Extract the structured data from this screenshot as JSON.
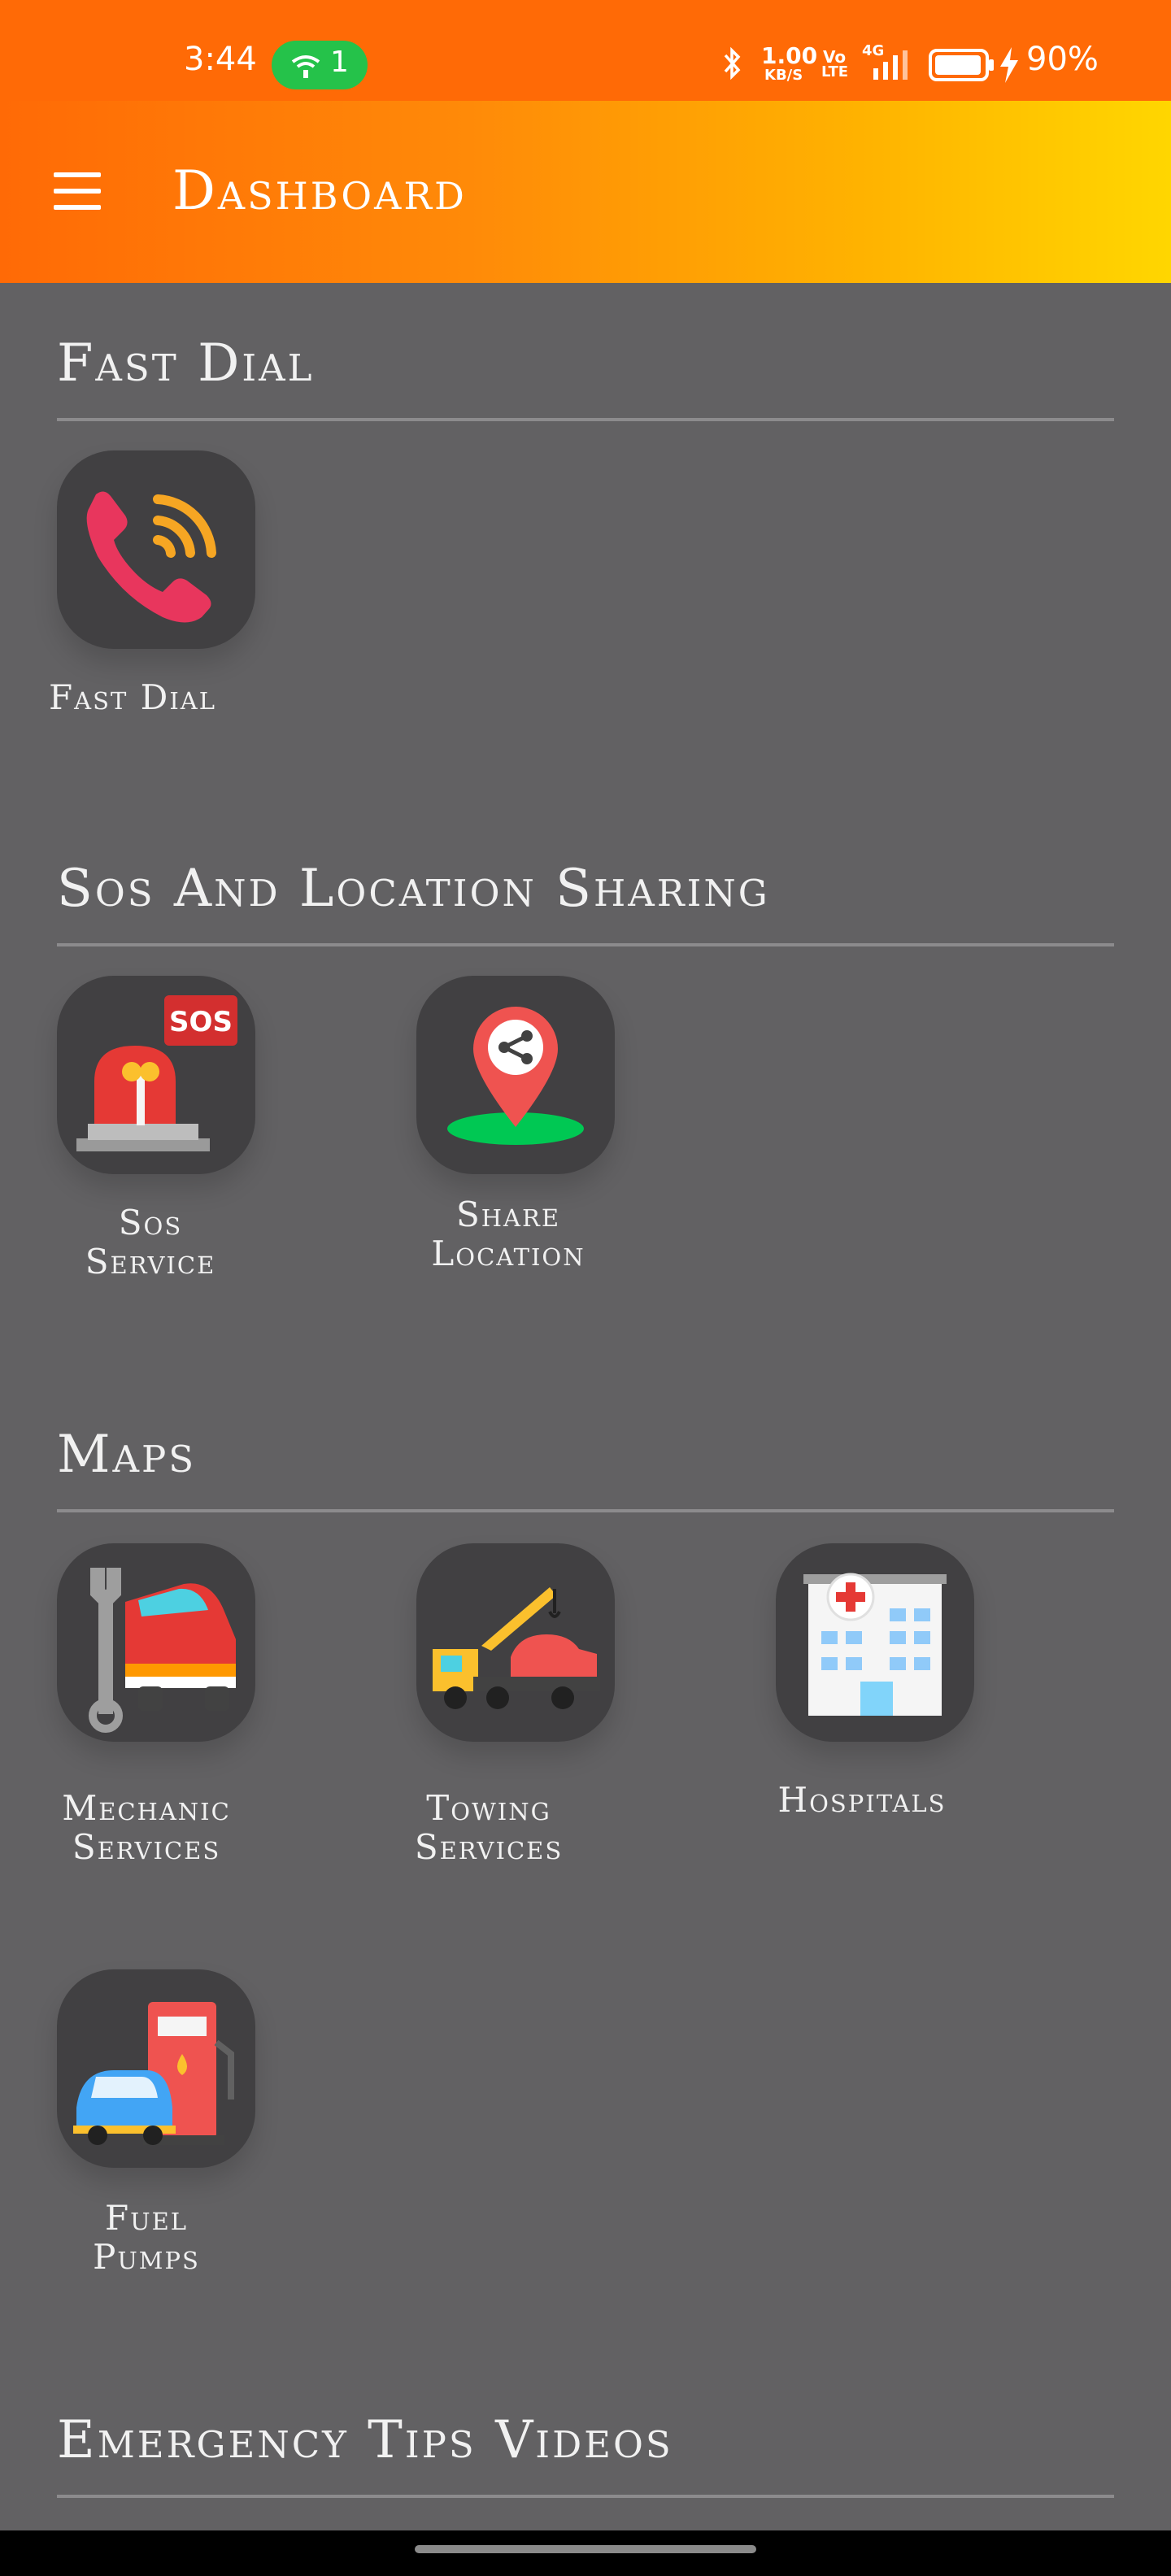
{
  "status_bar": {
    "time": "3:44",
    "hotspot_count": "1",
    "net_speed_value": "1.00",
    "net_speed_unit": "KB/S",
    "volte_top": "Vo",
    "volte_bottom": "LTE",
    "network_type": "4G",
    "battery_percent": "90%"
  },
  "app_bar": {
    "title": "Dashboard"
  },
  "sections": [
    {
      "title": "Fast Dial",
      "items": [
        {
          "label": "Fast Dial"
        }
      ]
    },
    {
      "title": "Sos And Location Sharing",
      "items": [
        {
          "label": "Sos\nService"
        },
        {
          "label": "Share\nLocation"
        }
      ]
    },
    {
      "title": "Maps",
      "items": [
        {
          "label": "Mechanic\nServices"
        },
        {
          "label": "Towing\nServices"
        },
        {
          "label": "Hospitals"
        },
        {
          "label": "Fuel\nPumps"
        }
      ]
    },
    {
      "title": "Emergency Tips Videos",
      "items": []
    }
  ],
  "icons": {
    "fast_dial": "phone-signal-icon",
    "sos": "siren-sos-icon",
    "share_location": "share-location-pin-icon",
    "mechanic": "mechanic-car-wrench-icon",
    "towing": "tow-truck-icon",
    "hospitals": "hospital-building-icon",
    "fuel": "fuel-pump-car-icon"
  },
  "colors": {
    "status_bar": "#ff6a06",
    "app_bar_start": "#ff6a06",
    "app_bar_end": "#ffd600",
    "background": "#626163",
    "tile": "#414042",
    "hotspot_pill": "#25c24a"
  }
}
